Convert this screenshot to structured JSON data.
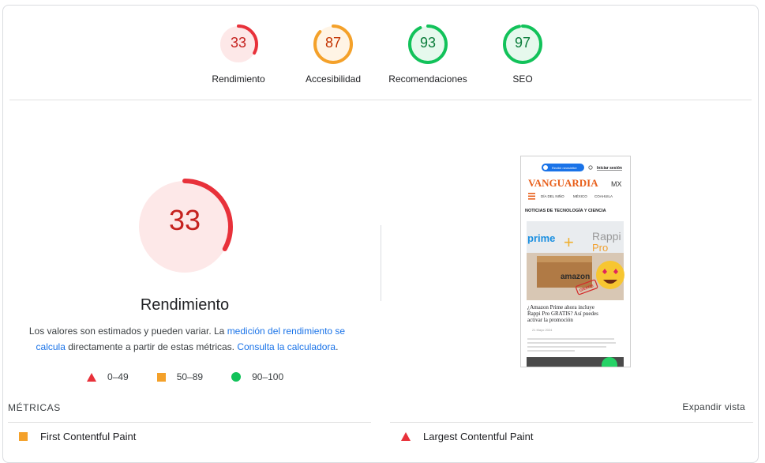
{
  "gauges": [
    {
      "score": "33",
      "label": "Rendimiento",
      "color": "#e8313a",
      "bg": "#fde8e8",
      "fraction": 0.33
    },
    {
      "score": "87",
      "label": "Accesibilidad",
      "color": "#f4a12a",
      "bg": "#fff4e5",
      "fraction": 0.87
    },
    {
      "score": "93",
      "label": "Recomendaciones",
      "color": "#12c25a",
      "bg": "#e6f9ed",
      "fraction": 0.93
    },
    {
      "score": "97",
      "label": "SEO",
      "color": "#12c25a",
      "bg": "#e6f9ed",
      "fraction": 0.97
    }
  ],
  "performance": {
    "score": "33",
    "fraction": 0.33,
    "title": "Rendimiento",
    "desc_part1": "Los valores son estimados y pueden variar. La ",
    "desc_link1": "medición del rendimiento se calcula",
    "desc_part2": " directamente a partir de estas métricas. ",
    "desc_link2": "Consulta la calculadora",
    "desc_part3": "."
  },
  "legend": {
    "fail": "0–49",
    "average": "50–89",
    "pass": "90–100"
  },
  "screenshot": {
    "button": "Recibir newsletter",
    "login": "Iniciar sesión",
    "logo_main": "VANGUARDIA",
    "logo_suffix": "MX",
    "nav1": "DÍA DEL NIÑO",
    "nav2": "MÉXICO",
    "nav3": "COAHUILA",
    "section": "NOTICIAS DE TECNOLOGÍA Y CIENCIA",
    "img_prime": "prime",
    "img_rappi": "Rappi",
    "img_pro": "Pro",
    "img_amazon": "amazon",
    "img_gratis": "GRATIS",
    "headline": "¿Amazon Prime ahora incluye Rappi Pro GRATIS? Así puedes activar la promoción",
    "date": "21 Mayo 2024"
  },
  "metrics": {
    "heading": "MÉTRICAS",
    "expand": "Expandir vista",
    "fcp": "First Contentful Paint",
    "lcp": "Largest Contentful Paint"
  }
}
